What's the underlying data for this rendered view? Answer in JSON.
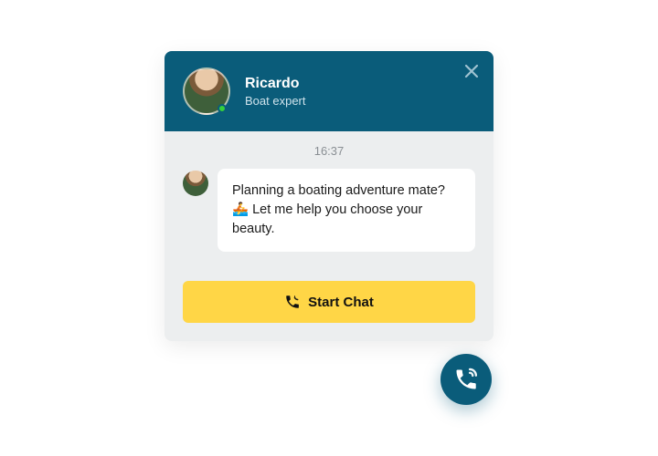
{
  "header": {
    "agent_name": "Ricardo",
    "agent_role": "Boat expert"
  },
  "timestamp": "16:37",
  "message": "Planning a boating adventure mate? 🚣 Let me help you choose your beauty.",
  "cta_label": "Start Chat"
}
